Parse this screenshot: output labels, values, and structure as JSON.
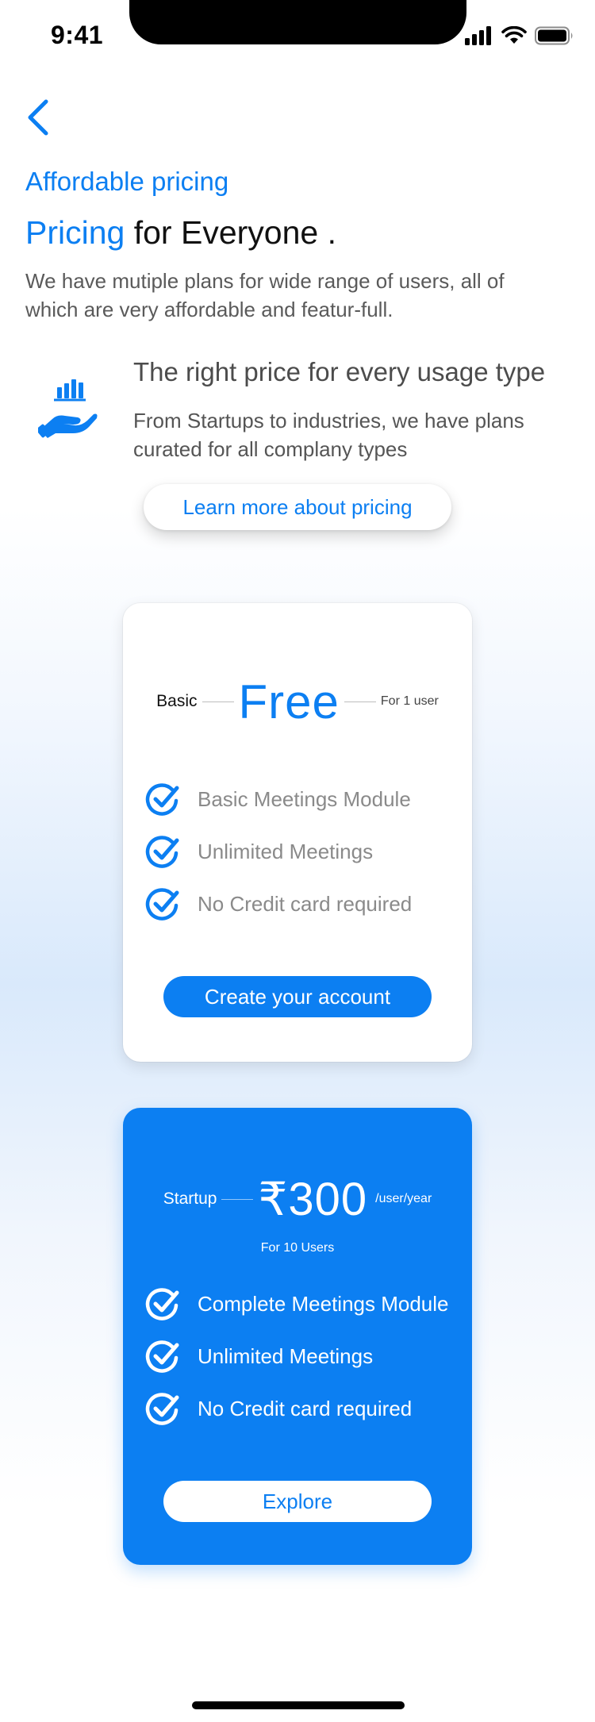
{
  "status_bar": {
    "time": "9:41"
  },
  "header": {
    "eyebrow": "Affordable pricing",
    "title_accent": "Pricing",
    "title_rest": "for Everyone .",
    "intro": "We have mutiple plans for wide range of users, all of which are very affordable and featur-full."
  },
  "feature": {
    "icon": "hand-chart-icon",
    "title": "The right price for every usage type",
    "text": "From Startups to industries, we have plans curated for all complany types",
    "learn_more": "Learn more about pricing"
  },
  "plans": [
    {
      "name": "Basic",
      "price": "Free",
      "note": "For 1 user",
      "features": [
        "Basic Meetings Module",
        "Unlimited Meetings",
        "No Credit card required"
      ],
      "cta": "Create your account"
    },
    {
      "name": "Startup",
      "price": "₹300",
      "unit": "/user/year",
      "note": "For 10 Users",
      "features": [
        "Complete  Meetings Module",
        "Unlimited Meetings",
        "No Credit card required"
      ],
      "cta": "Explore"
    }
  ],
  "colors": {
    "accent": "#0C7FF2",
    "body_text": "#5A5A5A"
  }
}
